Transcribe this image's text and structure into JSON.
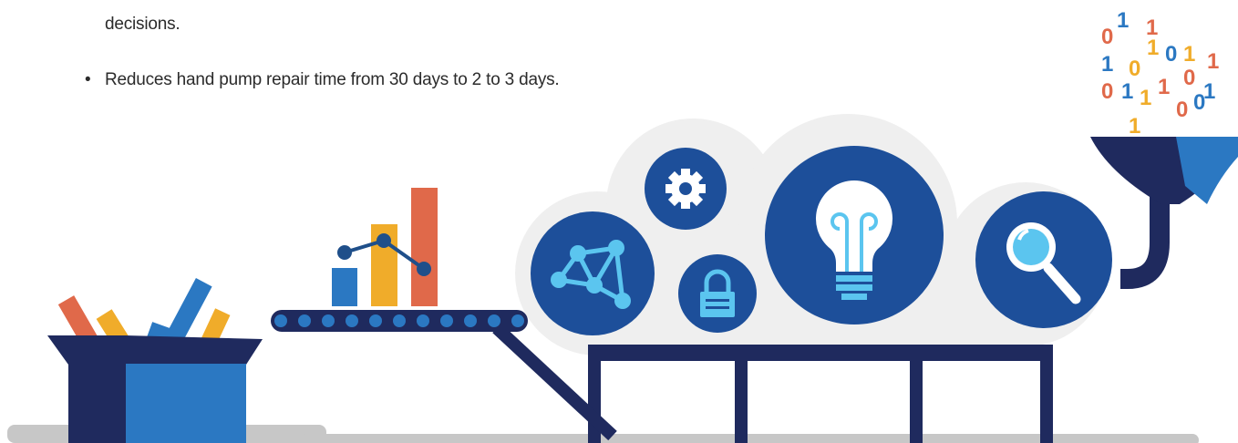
{
  "text": {
    "line1": "decisions.",
    "bullet_char": "•",
    "bullet": "Reduces hand pump repair time from 30 days to 2 to 3 days."
  },
  "colors": {
    "navy": "#1f2a5e",
    "blue": "#1d4f9a",
    "mid_blue": "#2b78c2",
    "light_blue": "#5bc5ef",
    "orange": "#e0694a",
    "yellow": "#f0ac2a",
    "cloud": "#efefef",
    "ground": "#c7c7c7"
  },
  "icons": [
    "network-icon",
    "gear-icon",
    "lock-icon",
    "lightbulb-icon",
    "magnifier-icon",
    "funnel-icon",
    "box-icon",
    "chart-icon",
    "conveyor-icon"
  ],
  "binary_digits": [
    "0",
    "1",
    "1",
    "1",
    "0",
    "0",
    "1",
    "1",
    "1",
    "0",
    "0",
    "1",
    "1",
    "0",
    "1",
    "1",
    "0",
    "1",
    "0",
    "0",
    "1"
  ]
}
